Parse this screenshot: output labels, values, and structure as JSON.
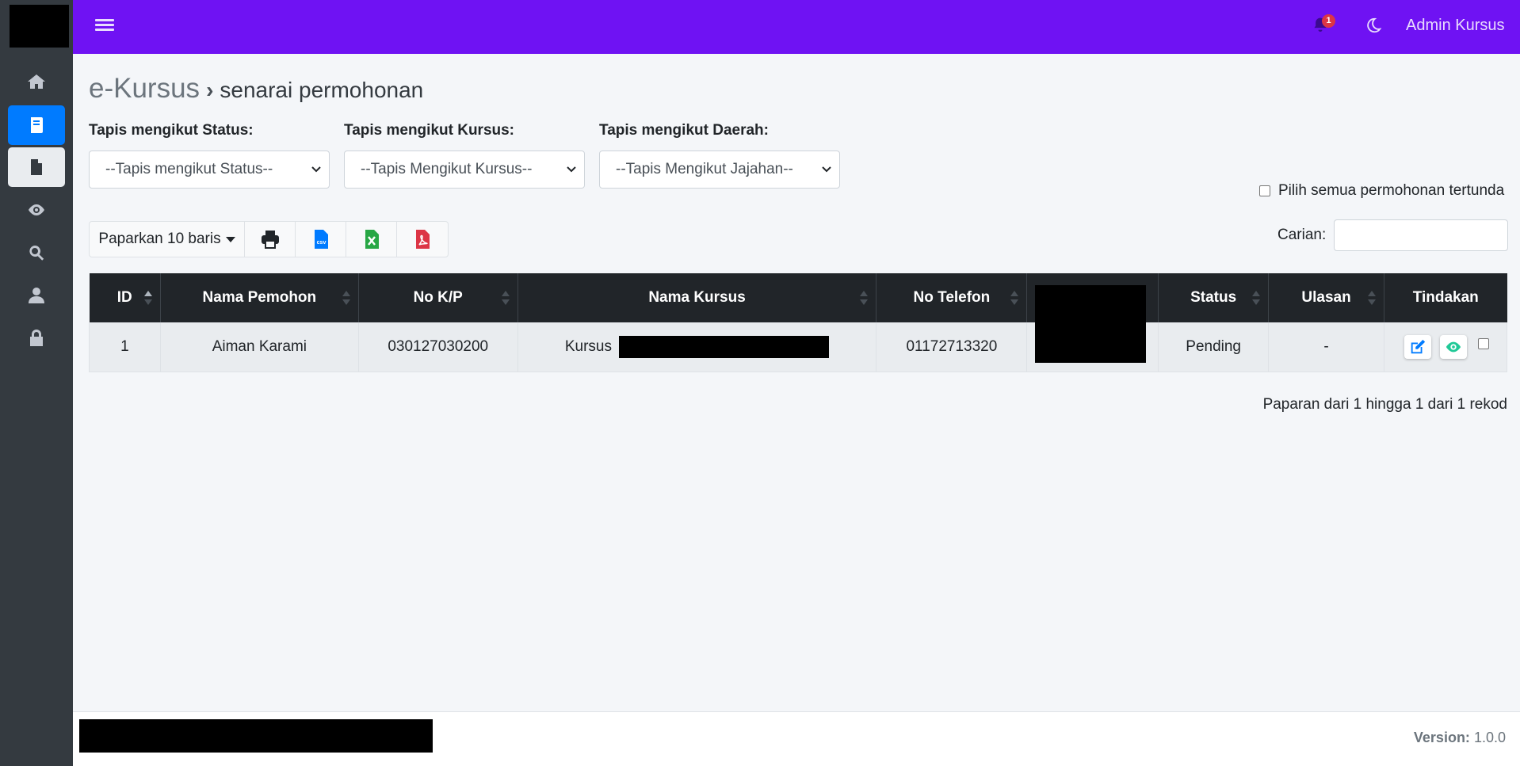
{
  "topbar": {
    "notification_count": "1",
    "admin_name": "Admin Kursus"
  },
  "sidebar": {
    "items": [
      {
        "icon": "home-icon"
      },
      {
        "icon": "book-icon"
      },
      {
        "icon": "file-icon"
      },
      {
        "icon": "eye-icon"
      },
      {
        "icon": "search-icon"
      },
      {
        "icon": "user-icon"
      },
      {
        "icon": "lock-icon"
      }
    ]
  },
  "breadcrumb": {
    "home": "e-Kursus",
    "separator": "›",
    "current": "senarai permohonan"
  },
  "filters": {
    "status": {
      "label": "Tapis mengikut Status:",
      "value": "--Tapis mengikut Status--"
    },
    "course": {
      "label": "Tapis mengikut Kursus:",
      "value": "--Tapis Mengikut Kursus--"
    },
    "region": {
      "label": "Tapis mengikut Daerah:",
      "value": "--Tapis Mengikut Jajahan--"
    }
  },
  "select_all_label": "Pilih semua permohonan tertunda",
  "toolbar": {
    "rows_label": "Paparkan 10 baris",
    "csv_text": "csv"
  },
  "search": {
    "label": "Carian:",
    "value": ""
  },
  "table": {
    "headers": {
      "id": "ID",
      "name": "Nama Pemohon",
      "ic": "No K/P",
      "course": "Nama Kursus",
      "phone": "No Telefon",
      "status": "Status",
      "review": "Ulasan",
      "action": "Tindakan"
    },
    "rows": [
      {
        "id": "1",
        "name": "Aiman Karami",
        "ic": "030127030200",
        "course_prefix": "Kursus",
        "phone": "01172713320",
        "status": "Pending",
        "review": "-"
      }
    ]
  },
  "table_info": "Paparan dari 1 hingga 1 dari 1 rekod",
  "footer": {
    "version_label": "Version:",
    "version_value": "1.0.0"
  },
  "colors": {
    "topbar": "#6f12f3",
    "sidebar": "#343a40",
    "active": "#007bff",
    "table_header": "#212529",
    "edit": "#007bff",
    "view": "#20c997"
  }
}
